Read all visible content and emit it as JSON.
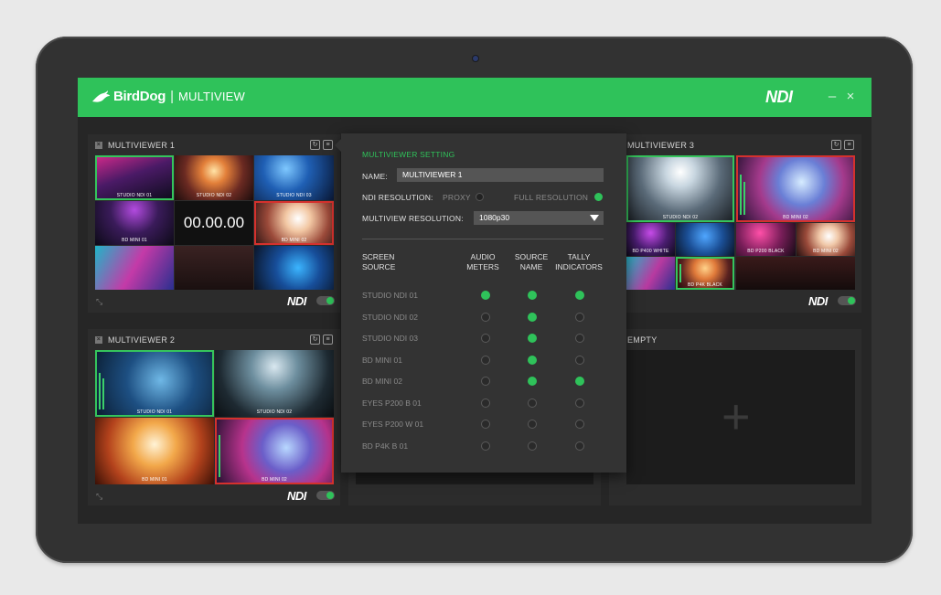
{
  "header": {
    "brand": "BirdDog",
    "separator": "|",
    "app_name": "MULTIVIEW",
    "ndi_logo": "NDI",
    "minimize": "–",
    "close": "×"
  },
  "panels": {
    "mv1": {
      "title": "MULTIVIEWER 1",
      "timer": "00.00.00",
      "tiles": [
        "STUDIO NDI 01",
        "STUDIO NDI 02",
        "STUDIO NDI 03",
        "BD MINI 01",
        "",
        "BD MINI 02",
        "",
        "",
        ""
      ],
      "ndi": "NDI"
    },
    "mv2": {
      "title": "MULTIVIEWER 2",
      "tiles": [
        "STUDIO NDI 01",
        "STUDIO NDI 02",
        "BD MINI 01",
        "BD MINI 02"
      ],
      "ndi": "NDI"
    },
    "mv3": {
      "title": "MULTIVIEWER 3",
      "tiles": [
        "STUDIO NDI 02",
        "BD MINI 02",
        "BD P400 WHITE",
        "",
        "BD P200 BLACK",
        "BD MINI 02",
        "",
        "BD P4K BLACK",
        ""
      ],
      "ndi": "NDI"
    },
    "empty": {
      "title": "EMPTY",
      "plus": "+"
    }
  },
  "settings": {
    "title": "MULTIVIEWER SETTING",
    "name_label": "NAME:",
    "name_value": "MULTIVIEWER 1",
    "ndi_res_label": "NDI RESOLUTION:",
    "opt_proxy": "PROXY",
    "opt_full": "FULL RESOLUTION",
    "selected_ndi_res": "FULL RESOLUTION",
    "mv_res_label": "MULTIVIEW RESOLUTION:",
    "mv_res_value": "1080p30",
    "col_source": [
      "SCREEN",
      "SOURCE"
    ],
    "col_audio": [
      "AUDIO",
      "METERS"
    ],
    "col_name": [
      "SOURCE",
      "NAME"
    ],
    "col_tally": [
      "TALLY",
      "INDICATORS"
    ],
    "sources": [
      {
        "name": "STUDIO NDI 01",
        "audio": true,
        "source_name": true,
        "tally": true
      },
      {
        "name": "STUDIO NDI 02",
        "audio": false,
        "source_name": true,
        "tally": false
      },
      {
        "name": "STUDIO NDI 03",
        "audio": false,
        "source_name": true,
        "tally": false
      },
      {
        "name": "BD MINI 01",
        "audio": false,
        "source_name": true,
        "tally": false
      },
      {
        "name": "BD MINI 02",
        "audio": false,
        "source_name": true,
        "tally": true
      },
      {
        "name": "EYES P200 B 01",
        "audio": false,
        "source_name": false,
        "tally": false
      },
      {
        "name": "EYES P200 W 01",
        "audio": false,
        "source_name": false,
        "tally": false
      },
      {
        "name": "BD P4K B 01",
        "audio": false,
        "source_name": false,
        "tally": false
      }
    ]
  },
  "colors": {
    "accent": "#2fc25a",
    "tally_red": "#d5312d"
  }
}
